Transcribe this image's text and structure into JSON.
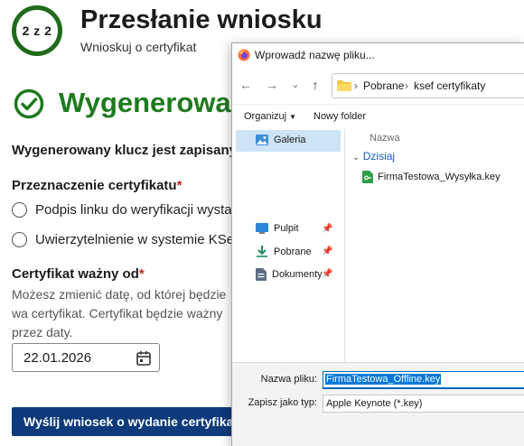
{
  "page": {
    "step_indicator": "2 z 2",
    "title": "Przesłanie wniosku",
    "subtitle": "Wnioskuj o certyfikat",
    "success_heading": "Wygenerowan",
    "info_text": "Wygenerowany klucz jest zapisany n",
    "purpose_label": "Przeznaczenie certyfikatu",
    "required_mark": "*",
    "purpose_options": [
      {
        "label": "Podpis linku do weryfikacji wystawcy"
      },
      {
        "label": "Uwierzytelnienie w systemie KSeF"
      }
    ],
    "valid_from_label": "Certyfikat ważny od",
    "valid_from_help": "Możesz zmienić datę, od której będzie wa certyfikat. Certyfikat będzie ważny przez daty.",
    "date_value": "22.01.2026",
    "submit_label": "Wyślij wniosek o wydanie certyfika",
    "colors": {
      "success_green": "#1f7a1f",
      "primary_blue": "#0d3a7a",
      "required_red": "#c0262d"
    }
  },
  "dialog": {
    "title": "Wprowadź nazwę pliku...",
    "breadcrumb": [
      "Pobrane",
      "ksef certyfikaty"
    ],
    "toolbar": {
      "organize": "Organizuj",
      "new_folder": "Nowy folder"
    },
    "nav_items": [
      {
        "label": "Galeria",
        "icon": "gallery-icon",
        "selected": true
      },
      {
        "label": "Pulpit",
        "icon": "desktop-icon"
      },
      {
        "label": "Pobrane",
        "icon": "download-icon"
      },
      {
        "label": "Dokumenty",
        "icon": "documents-icon"
      }
    ],
    "column_name": "Nazwa",
    "group_today": "Dzisiaj",
    "files": [
      {
        "name": "FirmaTestowa_Wysyłka.key"
      }
    ],
    "filename_label": "Nazwa pliku:",
    "filename_value": "FirmaTestowa_Offline.key",
    "filetype_label": "Zapisz jako typ:",
    "filetype_value": "Apple Keynote (*.key)"
  }
}
